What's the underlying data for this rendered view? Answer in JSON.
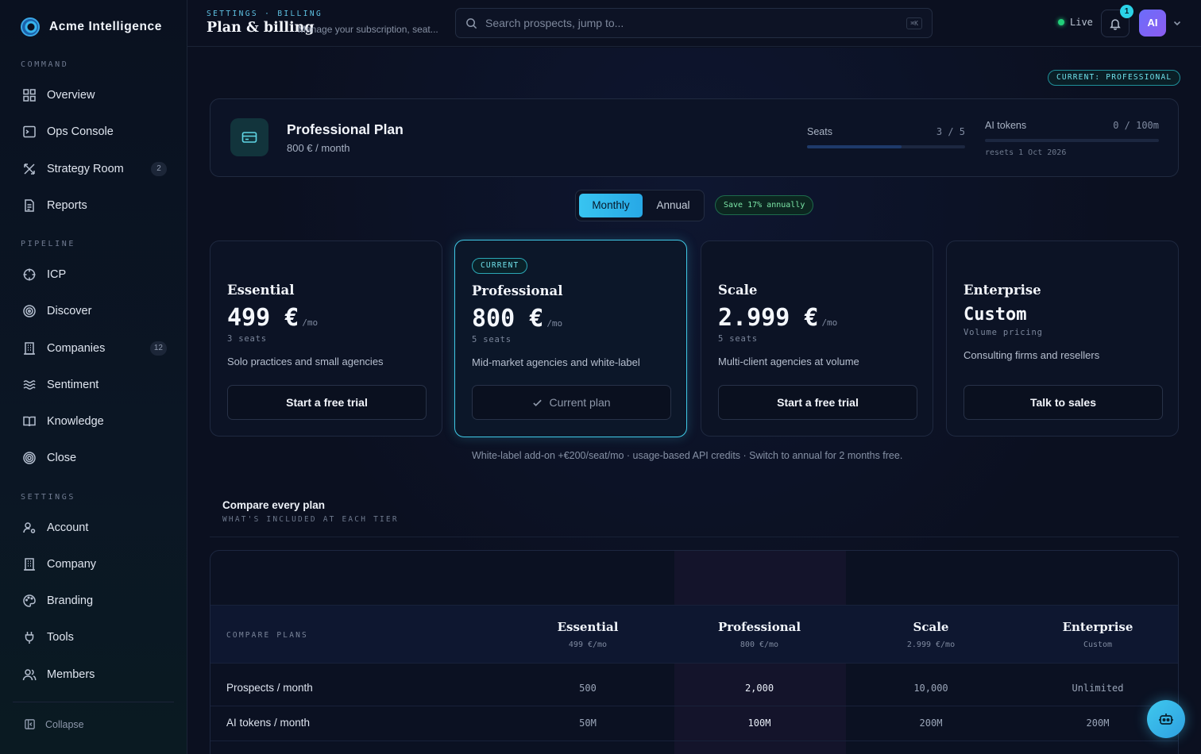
{
  "brand": {
    "name": "Acme Intelligence"
  },
  "sidebar": {
    "sections": [
      {
        "label": "COMMAND",
        "items": [
          {
            "label": "Overview",
            "icon": "grid-icon",
            "badge": ""
          },
          {
            "label": "Ops Console",
            "icon": "terminal-icon",
            "badge": ""
          },
          {
            "label": "Strategy Room",
            "icon": "strategy-icon",
            "badge": "2"
          },
          {
            "label": "Reports",
            "icon": "document-icon",
            "badge": ""
          }
        ]
      },
      {
        "label": "PIPELINE",
        "items": [
          {
            "label": "ICP",
            "icon": "crosshair-icon",
            "badge": ""
          },
          {
            "label": "Discover",
            "icon": "radar-icon",
            "badge": ""
          },
          {
            "label": "Companies",
            "icon": "building-icon",
            "badge": "12"
          },
          {
            "label": "Sentiment",
            "icon": "waves-icon",
            "badge": ""
          },
          {
            "label": "Knowledge",
            "icon": "book-icon",
            "badge": ""
          },
          {
            "label": "Close",
            "icon": "target-icon",
            "badge": ""
          }
        ]
      },
      {
        "label": "SETTINGS",
        "items": [
          {
            "label": "Account",
            "icon": "user-gear-icon",
            "badge": ""
          },
          {
            "label": "Company",
            "icon": "building-icon",
            "badge": ""
          },
          {
            "label": "Branding",
            "icon": "palette-icon",
            "badge": ""
          },
          {
            "label": "Tools",
            "icon": "plug-icon",
            "badge": ""
          },
          {
            "label": "Members",
            "icon": "users-icon",
            "badge": ""
          }
        ]
      }
    ],
    "collapse_label": "Collapse"
  },
  "header": {
    "breadcrumb": "SETTINGS · BILLING",
    "title": "Plan & billing",
    "subtitle": "Manage your subscription, seat...",
    "search_placeholder": "Search prospects, jump to...",
    "search_shortcut": "⌘K",
    "status": "Live",
    "notifications": "1",
    "avatar_initials": "AI"
  },
  "current_plan_pill": "CURRENT: PROFESSIONAL",
  "plan_summary": {
    "name": "Professional Plan",
    "price": "800 € / month",
    "seats_label": "Seats",
    "seats_value": "3 / 5",
    "seats_fraction": 0.6,
    "tokens_label": "AI tokens",
    "tokens_value": "0 / 100m",
    "tokens_fraction": 0.0,
    "tokens_note": "resets 1 Oct 2026"
  },
  "billing_toggle": {
    "monthly": "Monthly",
    "annual": "Annual",
    "selected": "Monthly",
    "save_note": "Save 17% annually"
  },
  "tiers": [
    {
      "badge": "",
      "name": "Essential",
      "price": "499 €",
      "per": "/mo",
      "seats": "3 seats",
      "desc": "Solo practices and small agencies",
      "cta": "Start a free trial"
    },
    {
      "badge": "CURRENT",
      "name": "Professional",
      "price": "800 €",
      "per": "/mo",
      "seats": "5 seats",
      "desc": "Mid-market agencies and white-label",
      "cta": "Current plan"
    },
    {
      "badge": "",
      "name": "Scale",
      "price": "2.999 €",
      "per": "/mo",
      "seats": "5 seats",
      "desc": "Multi-client agencies at volume",
      "cta": "Start a free trial"
    },
    {
      "badge": "",
      "name": "Enterprise",
      "price": "Custom",
      "per": "",
      "seats": "Volume pricing",
      "desc": "Consulting firms and resellers",
      "cta": "Talk to sales"
    }
  ],
  "footnote": "White-label add-on +€200/seat/mo · usage-based API credits · Switch to annual for 2 months free.",
  "compare": {
    "title": "Compare every plan",
    "subtitle": "WHAT'S INCLUDED AT EACH TIER",
    "head_label": "COMPARE PLANS",
    "columns": [
      {
        "name": "Essential",
        "price": "499 €/mo"
      },
      {
        "name": "Professional",
        "price": "800 €/mo"
      },
      {
        "name": "Scale",
        "price": "2.999 €/mo"
      },
      {
        "name": "Enterprise",
        "price": "Custom"
      }
    ],
    "rows": [
      {
        "label": "Prospects / month",
        "values": [
          "500",
          "2,000",
          "10,000",
          "Unlimited"
        ]
      },
      {
        "label": "AI tokens / month",
        "values": [
          "50M",
          "100M",
          "200M",
          "200M"
        ]
      }
    ]
  },
  "colors": {
    "accent": "#38c4f0",
    "background": "#0b1020",
    "live": "#22d07a",
    "save": "#7ce7a8"
  }
}
